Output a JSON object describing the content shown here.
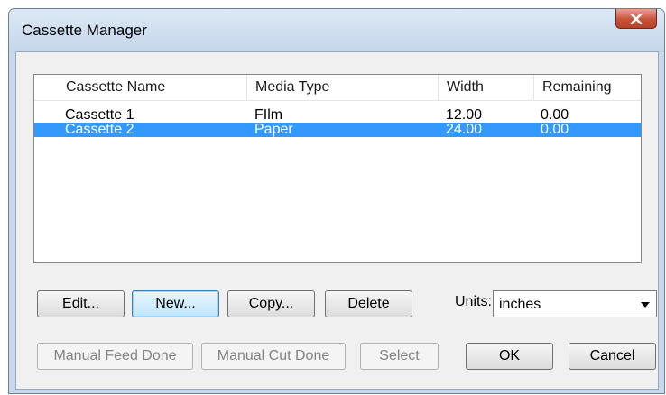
{
  "window": {
    "title": "Cassette Manager"
  },
  "list": {
    "columns": [
      "Cassette Name",
      "Media Type",
      "Width",
      "Remaining"
    ],
    "rows": [
      {
        "name": "Cassette 1",
        "media": "FIlm",
        "width": "12.00",
        "remaining": "0.00",
        "selected": false
      },
      {
        "name": "Cassette 2",
        "media": "Paper",
        "width": "24.00",
        "remaining": "0.00",
        "selected": true
      }
    ]
  },
  "buttons": {
    "edit": "Edit...",
    "new": "New...",
    "copy": "Copy...",
    "delete": "Delete",
    "manual_feed_done": "Manual Feed Done",
    "manual_cut_done": "Manual Cut Done",
    "select": "Select",
    "ok": "OK",
    "cancel": "Cancel"
  },
  "units": {
    "label": "Units:",
    "value": "inches"
  },
  "colors": {
    "selection": "#3399ff",
    "close": "#c9533a"
  }
}
